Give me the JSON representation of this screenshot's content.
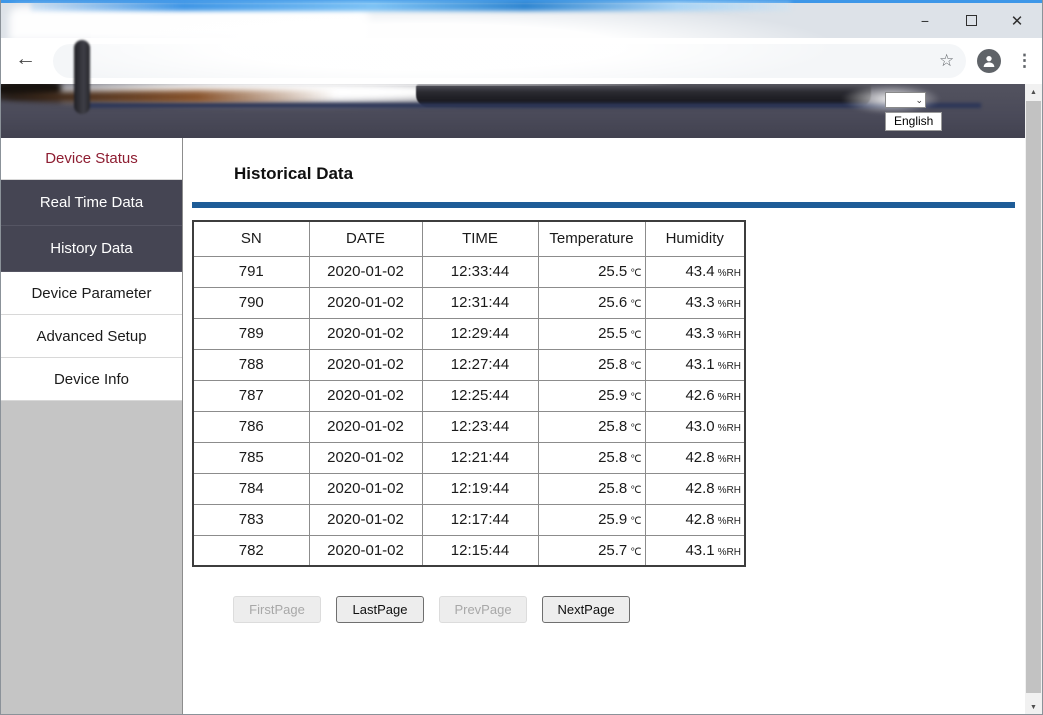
{
  "icons": {
    "minimize": "−",
    "maximize": "maximize-box",
    "close": "✕",
    "back": "←",
    "bookmark_star": "☆",
    "profile": "person-avatar",
    "menu_dots": "⋮",
    "dropdown_caret": "⌄",
    "scroll_up": "▲",
    "scroll_down": "▼"
  },
  "banner": {
    "language_option": "English"
  },
  "sidebar": {
    "items": [
      {
        "label": "Device Status",
        "variant": "v-red",
        "active": false
      },
      {
        "label": "Real Time Data",
        "variant": "v-dark",
        "active": true
      },
      {
        "label": "History Data",
        "variant": "v-dark",
        "active": true
      },
      {
        "label": "Device Parameter",
        "variant": "v-light",
        "active": false
      },
      {
        "label": "Advanced Setup",
        "variant": "v-light",
        "active": false
      },
      {
        "label": "Device Info",
        "variant": "v-light",
        "active": false
      }
    ]
  },
  "page": {
    "title": "Historical Data",
    "accent_color": "#1e5c97"
  },
  "table": {
    "columns": [
      "SN",
      "DATE",
      "TIME",
      "Temperature",
      "Humidity"
    ],
    "units": {
      "temperature": "℃",
      "humidity": "%RH"
    },
    "rows": [
      {
        "sn": "791",
        "date": "2020-01-02",
        "time": "12:33:44",
        "temperature": "25.5",
        "humidity": "43.4"
      },
      {
        "sn": "790",
        "date": "2020-01-02",
        "time": "12:31:44",
        "temperature": "25.6",
        "humidity": "43.3"
      },
      {
        "sn": "789",
        "date": "2020-01-02",
        "time": "12:29:44",
        "temperature": "25.5",
        "humidity": "43.3"
      },
      {
        "sn": "788",
        "date": "2020-01-02",
        "time": "12:27:44",
        "temperature": "25.8",
        "humidity": "43.1"
      },
      {
        "sn": "787",
        "date": "2020-01-02",
        "time": "12:25:44",
        "temperature": "25.9",
        "humidity": "42.6"
      },
      {
        "sn": "786",
        "date": "2020-01-02",
        "time": "12:23:44",
        "temperature": "25.8",
        "humidity": "43.0"
      },
      {
        "sn": "785",
        "date": "2020-01-02",
        "time": "12:21:44",
        "temperature": "25.8",
        "humidity": "42.8"
      },
      {
        "sn": "784",
        "date": "2020-01-02",
        "time": "12:19:44",
        "temperature": "25.8",
        "humidity": "42.8"
      },
      {
        "sn": "783",
        "date": "2020-01-02",
        "time": "12:17:44",
        "temperature": "25.9",
        "humidity": "42.8"
      },
      {
        "sn": "782",
        "date": "2020-01-02",
        "time": "12:15:44",
        "temperature": "25.7",
        "humidity": "43.1"
      }
    ]
  },
  "pagination": {
    "buttons": [
      {
        "label": "FirstPage",
        "enabled": false
      },
      {
        "label": "LastPage",
        "enabled": true
      },
      {
        "label": "PrevPage",
        "enabled": false
      },
      {
        "label": "NextPage",
        "enabled": true
      }
    ]
  }
}
